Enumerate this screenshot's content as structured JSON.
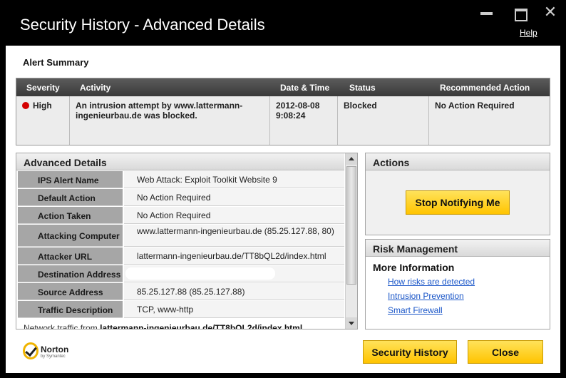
{
  "window": {
    "title": "Security History - Advanced Details",
    "help_label": "Help"
  },
  "alert_summary": {
    "title": "Alert Summary",
    "columns": [
      "Severity",
      "Activity",
      "Date & Time",
      "Status",
      "Recommended Action"
    ],
    "row": {
      "severity": "High",
      "activity": "An intrusion attempt by www.lattermann-ingenieurbau.de was blocked.",
      "datetime_line1": "2012-08-08",
      "datetime_line2": "9:08:24",
      "status": "Blocked",
      "recommended_action": "No Action Required"
    },
    "severity_color": "#d40000"
  },
  "advanced_details": {
    "title": "Advanced Details",
    "rows": [
      {
        "label": "IPS Alert Name",
        "value": "Web Attack: Exploit Toolkit Website 9"
      },
      {
        "label": "Default Action",
        "value": "No Action Required"
      },
      {
        "label": "Action Taken",
        "value": "No Action Required"
      },
      {
        "label": "Attacking Computer",
        "value": "www.lattermann-ingenieurbau.de (85.25.127.88, 80)"
      },
      {
        "label": "Attacker URL",
        "value": "lattermann-ingenieurbau.de/TT8bQL2d/index.html"
      },
      {
        "label": "Destination Address",
        "value": ""
      },
      {
        "label": "Source Address",
        "value": "85.25.127.88 (85.25.127.88)"
      },
      {
        "label": "Traffic Description",
        "value": "TCP, www-http"
      }
    ],
    "footer_text_prefix": "Network traffic from ",
    "footer_text_bold": "lattermann-ingenieurbau.de/TT8bQL2d/index.html"
  },
  "actions": {
    "title": "Actions",
    "stop_notifying_label": "Stop Notifying Me"
  },
  "risk_management": {
    "title": "Risk Management",
    "more_info": "More Information",
    "links": [
      "How risks are detected",
      "Intrusion Prevention",
      "Smart Firewall"
    ]
  },
  "footer": {
    "brand": "Norton",
    "brand_sub": "by Symantec",
    "security_history_label": "Security History",
    "close_label": "Close"
  },
  "colors": {
    "accent_button": "#ffc400",
    "link": "#1a56c8"
  }
}
